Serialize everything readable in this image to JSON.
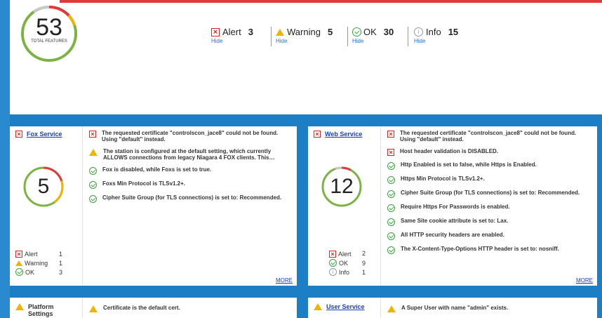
{
  "summary": {
    "total": "53",
    "total_label": "TOTAL FEATURES",
    "alert": {
      "label": "Alert",
      "count": "3",
      "hide": "Hide"
    },
    "warning": {
      "label": "Warning",
      "count": "5",
      "hide": "Hide"
    },
    "ok": {
      "label": "OK",
      "count": "30",
      "hide": "Hide"
    },
    "info": {
      "label": "Info",
      "count": "15",
      "hide": "Hide"
    }
  },
  "fox": {
    "title": "Fox Service",
    "count": "5",
    "items": [
      "The requested certificate \"controlscon_jace8\" could not be found. Using \"default\" instead.",
      "The station is configured at the default setting, which currently ALLOWS connections from legacy Niagara 4 FOX clients. This…",
      "Fox is disabled, while Foxs is set to true.",
      "Foxs Min Protocol is TLSv1.2+.",
      "Cipher Suite Group (for TLS connections) is set to: Recommended."
    ],
    "counts": {
      "alert_label": "Alert",
      "alert": "1",
      "warning_label": "Warning",
      "warning": "1",
      "ok_label": "OK",
      "ok": "3"
    },
    "more": "MORE"
  },
  "web": {
    "title": "Web Service",
    "count": "12",
    "items": [
      "The requested certificate \"controlscon_jace8\" could not be found. Using \"default\" instead.",
      "Host header validation is DISABLED.",
      "Http Enabled is set to false, while Https is Enabled.",
      "Https Min Protocol is TLSv1.2+.",
      "Cipher Suite Group (for TLS connections) is set to: Recommended.",
      "Require Https For Passwords is enabled.",
      "Same Site cookie attribute is set to: Lax.",
      "All HTTP security headers are enabled.",
      "The X-Content-Type-Options HTTP header is set to: nosniff."
    ],
    "counts": {
      "alert_label": "Alert",
      "alert": "2",
      "ok_label": "OK",
      "ok": "9",
      "info_label": "Info",
      "info": "1"
    },
    "more": "MORE"
  },
  "platform": {
    "title": "Platform Settings",
    "item": "Certificate is the default cert."
  },
  "user": {
    "title": "User Service",
    "item": "A Super User with name \"admin\" exists."
  },
  "colors": {
    "alert": "#d22222",
    "warning": "#f0b400",
    "ok": "#3aa33a",
    "info": "#999999",
    "link": "#1a3fbf"
  }
}
